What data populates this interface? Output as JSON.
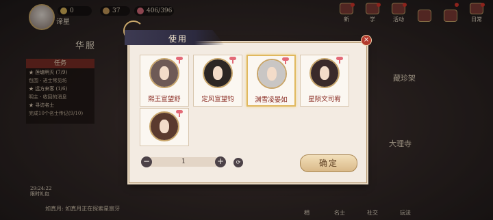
{
  "top": {
    "player_name": "谛星",
    "resources": [
      {
        "icon": "coin-icon",
        "value": "0",
        "color": "#d9b45a"
      },
      {
        "icon": "stamina-icon",
        "value": "37",
        "color": "#c79a5a"
      },
      {
        "icon": "flower-icon",
        "value": "406/396",
        "color": "#d86a7a"
      }
    ],
    "icons": [
      {
        "label": "新",
        "name": "new-icon"
      },
      {
        "label": "学",
        "name": "study-icon"
      },
      {
        "label": "活动",
        "name": "activity-icon"
      },
      {
        "label": "",
        "name": "gift-icon"
      },
      {
        "label": "",
        "name": "mail-icon"
      },
      {
        "label": "日常",
        "name": "daily-icon"
      }
    ]
  },
  "left": {
    "area": "华服",
    "task_header": "任务",
    "tasks": [
      {
        "title": "★ 莲塘明灭 (7/9)",
        "sub": "包围 · 进士常见坊"
      },
      {
        "title": "★ 远方来客 (1/6)",
        "sub": "明主 · 收回的消息"
      },
      {
        "title": "★ 寻访名士",
        "sub": "完成10个名士传记(9/10)"
      }
    ],
    "clock": "29:24:22",
    "clock_label": "限时礼包",
    "bottom_text": "如真月: 如真月正在探索星宸牙"
  },
  "side": {
    "right_label_1": "藏珍架",
    "right_label_2": "大理寺"
  },
  "bottom_icons": [
    "相",
    "名士",
    "社交",
    "玩法"
  ],
  "dialog": {
    "title": "使用",
    "close": "×",
    "characters": [
      {
        "name": "熙王宣望舒",
        "hair": "#6e5a56",
        "selected": false
      },
      {
        "name": "定风宣望钧",
        "hair": "#2c2624",
        "selected": false
      },
      {
        "name": "渊雪凌晏如",
        "hair": "#c9c6c4",
        "selected": true
      },
      {
        "name": "星陨文司宥",
        "hair": "#3a2a2a",
        "selected": false
      },
      {
        "name": "",
        "hair": "#5a3a2e",
        "selected": false
      }
    ],
    "quantity": "1",
    "minus": "−",
    "plus": "+",
    "max": "⟳",
    "confirm": "确定"
  }
}
